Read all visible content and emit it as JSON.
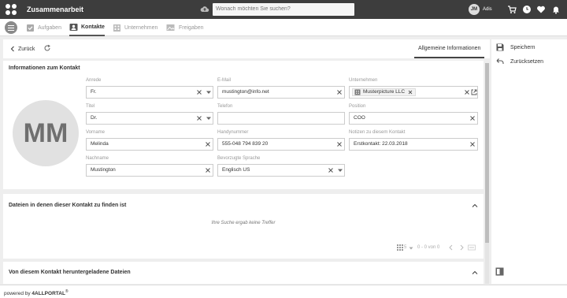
{
  "app": {
    "title": "Zusammenarbeit",
    "user_initials": "JM",
    "user_name": "Adis"
  },
  "search": {
    "placeholder": "Wonach möchten Sie suchen?"
  },
  "tabs": [
    {
      "label": "Aufgaben"
    },
    {
      "label": "Kontakte"
    },
    {
      "label": "Unternehmen"
    },
    {
      "label": "Freigaben"
    }
  ],
  "header": {
    "back_label": "Zurück",
    "active_tab": "Allgemeine Informationen"
  },
  "contact_card": {
    "title": "Informationen zum Kontakt",
    "initials": "MM",
    "fields": {
      "anrede": {
        "label": "Anrede",
        "value": "Fr."
      },
      "email": {
        "label": "E-Mail",
        "value": "mustington@info.net"
      },
      "unternehmen": {
        "label": "Unternehmen",
        "value": "Musterpicture LLC"
      },
      "titel": {
        "label": "Titel",
        "value": "Dr."
      },
      "telefon": {
        "label": "Telefon",
        "value": ""
      },
      "position": {
        "label": "Position",
        "value": "COO"
      },
      "vorname": {
        "label": "Vorname",
        "value": "Melinda"
      },
      "handynummer": {
        "label": "Handynummer",
        "value": "555-048 794 839 20"
      },
      "notizen": {
        "label": "Notizen zu diesem Kontakt",
        "value": "Erstkontakt: 22.03.2018"
      },
      "nachname": {
        "label": "Nachname",
        "value": "Mustington"
      },
      "sprache": {
        "label": "Bevorzugte Sprache",
        "value": "Englisch US"
      }
    }
  },
  "files_card": {
    "title": "Dateien in denen dieser Kontakt zu finden ist",
    "empty_message": "Ihre Suche ergab keine Treffer",
    "page_size": "5",
    "range": "0 - 0 von 0"
  },
  "downloads_card": {
    "title": "Von diesem Kontakt heruntergeladene Dateien"
  },
  "side_actions": {
    "save": "Speichern",
    "reset": "Zurücksetzen"
  },
  "footer": {
    "powered_by": "powered by",
    "brand": "4ALLPORTAL",
    "reg": "®"
  }
}
